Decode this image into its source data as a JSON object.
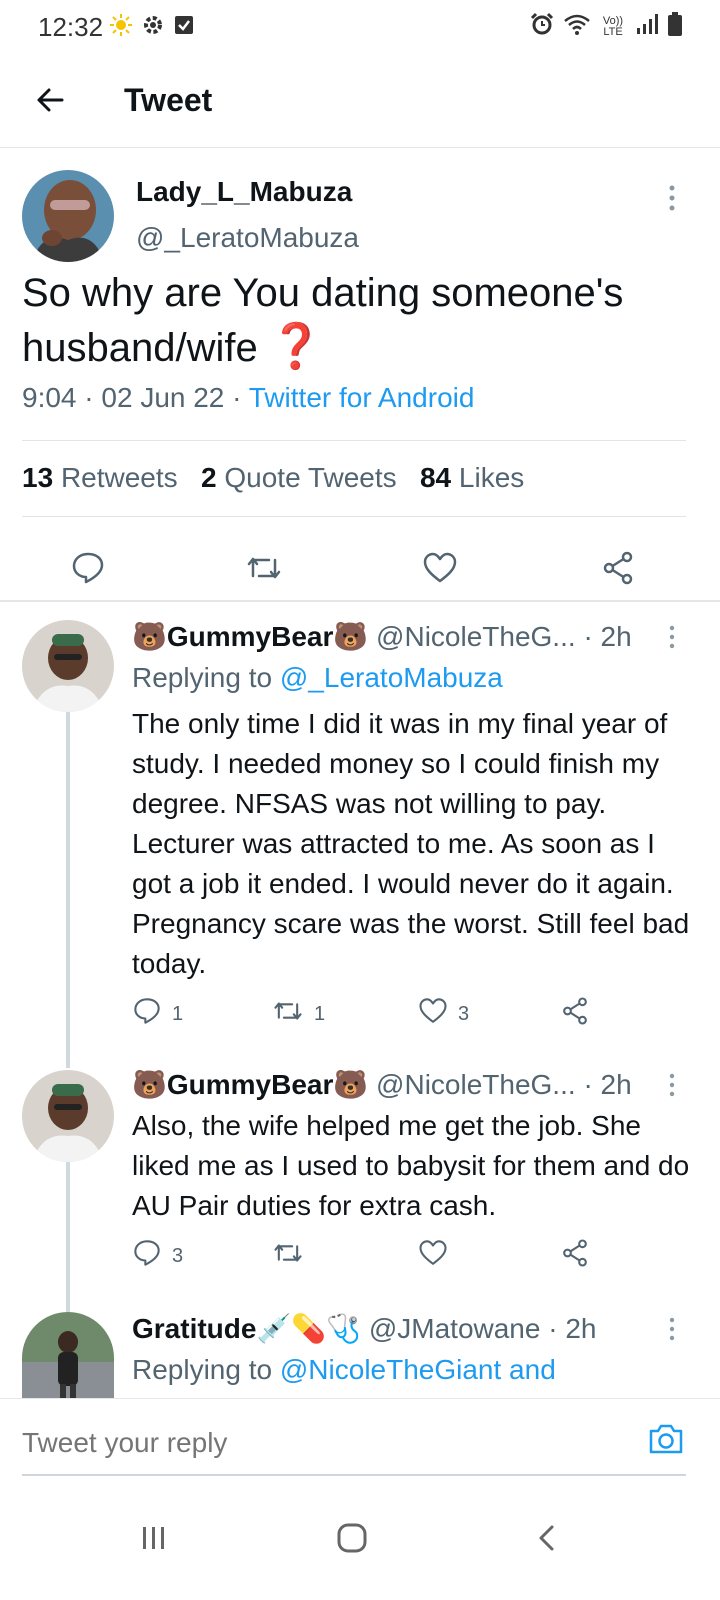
{
  "status_bar": {
    "time": "12:32",
    "left_icons": [
      "sun-icon",
      "gear-icon",
      "checkbox-icon"
    ],
    "right_icons": [
      "alarm-icon",
      "wifi-icon",
      "volte-icon",
      "signal-icon",
      "battery-icon"
    ],
    "volte_label": "Vo)) LTE"
  },
  "app_bar": {
    "title": "Tweet",
    "back_icon": "arrow-left-icon"
  },
  "main_tweet": {
    "author_name": "Lady_L_Mabuza",
    "author_handle": "@_LeratoMabuza",
    "text": "So why are You dating someone's husband/wife",
    "emoji": "❓",
    "time": "9:04",
    "date": "02 Jun 22",
    "source": "Twitter for Android",
    "retweets_count": "13",
    "retweets_label": "Retweets",
    "quote_count": "2",
    "quote_label": "Quote Tweets",
    "likes_count": "84",
    "likes_label": "Likes"
  },
  "replies": [
    {
      "name": "GummyBear",
      "name_emoji": "🐻",
      "handle": "@NicoleTheG...",
      "time": "· 2h",
      "replying_prefix": "Replying to",
      "replying_to": "@_LeratoMabuza",
      "text": "The only time I did it was in my final year of study. I needed money so I could finish my degree. NFSAS was not willing to pay. Lecturer was attracted to me. As soon as I got a job it ended. I would never do it again. Pregnancy scare was the worst. Still feel bad today.",
      "reply_count": "1",
      "retweet_count": "1",
      "like_count": "3"
    },
    {
      "name": "GummyBear",
      "name_emoji": "🐻",
      "handle": "@NicoleTheG...",
      "time": "· 2h",
      "text": "Also, the wife helped me get the job. She liked me as I used to babysit for them and do AU Pair duties for extra cash.",
      "reply_count": "3",
      "retweet_count": "",
      "like_count": ""
    },
    {
      "name": "Gratitude",
      "name_emoji": "💉💊🩺",
      "handle": "@JMatowane",
      "time": "· 2h",
      "replying_prefix": "Replying to",
      "replying_to": "@NicoleTheGiant and"
    }
  ],
  "composer": {
    "placeholder": "Tweet your reply"
  },
  "colors": {
    "link": "#1d9bf0",
    "secondary_text": "#536471",
    "question_mark": "#c0142b"
  }
}
